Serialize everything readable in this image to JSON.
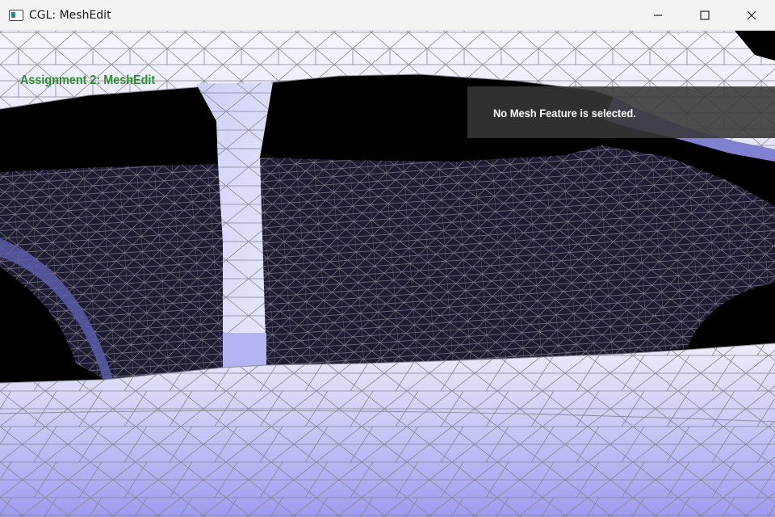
{
  "window": {
    "title": "CGL: MeshEdit",
    "controls": {
      "minimize": "minimize-icon",
      "maximize": "maximize-icon",
      "close": "close-icon"
    }
  },
  "overlay": {
    "assignment_label": "Assignment 2: MeshEdit",
    "status_message": "No Mesh Feature is selected."
  },
  "colors": {
    "label_green": "#2e8b2e",
    "mesh_light": "#e6e6fb",
    "mesh_mid": "#9f9ff0",
    "mesh_dark_inner": "#1d1c33",
    "wire": "#8a8a8f",
    "background": "#000000"
  }
}
